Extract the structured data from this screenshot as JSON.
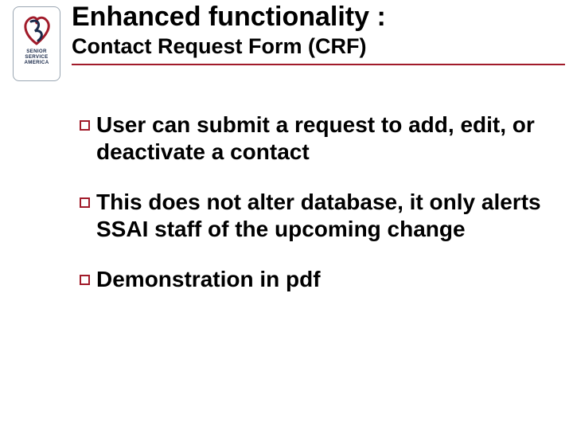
{
  "logo": {
    "line1": "SENIOR",
    "line2": "SERVICE",
    "line3": "AMERICA"
  },
  "header": {
    "title": "Enhanced functionality :",
    "subtitle": "Contact Request Form (CRF)"
  },
  "bullets": [
    "User can submit a request to add, edit, or deactivate a contact",
    "This does not alter database, it only alerts SSAI staff of the upcoming change",
    "Demonstration in pdf"
  ],
  "colors": {
    "accent": "#a11b2a"
  }
}
